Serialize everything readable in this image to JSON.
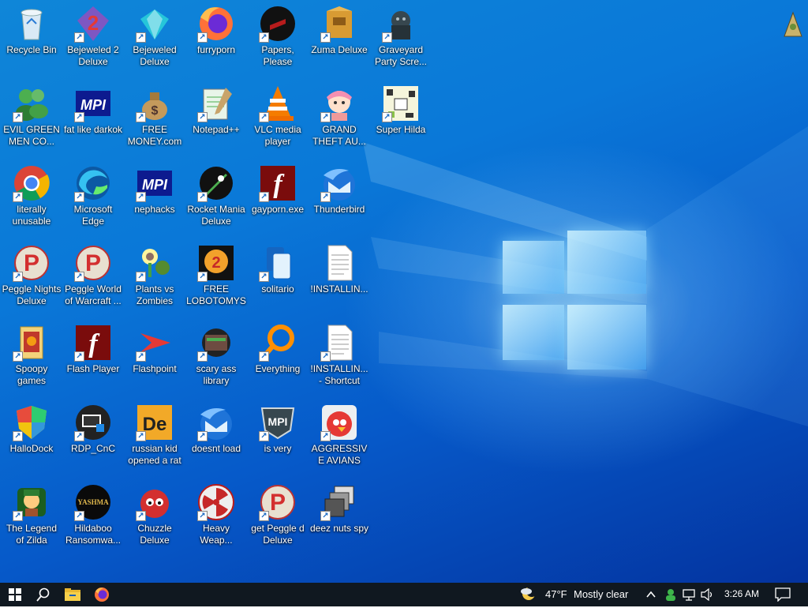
{
  "desktop": {
    "icons": [
      {
        "label": "Recycle Bin",
        "icon": "recycle-bin-icon"
      },
      {
        "label": "EVIL GREEN MEN CO...",
        "icon": "green-men-icon"
      },
      {
        "label": "literally unusable",
        "icon": "chrome-icon"
      },
      {
        "label": "Peggle Nights Deluxe",
        "icon": "peggle-icon"
      },
      {
        "label": "Spoopy games",
        "icon": "folder-icon"
      },
      {
        "label": "HalloDock",
        "icon": "shield-icon"
      },
      {
        "label": "The Legend of Zilda",
        "icon": "zilda-icon"
      },
      {
        "label": "Bejeweled 2 Deluxe",
        "icon": "bejeweled2-icon"
      },
      {
        "label": "fat like darkok",
        "icon": "mpi-icon"
      },
      {
        "label": "Microsoft Edge",
        "icon": "edge-icon"
      },
      {
        "label": "Peggle World of Warcraft ...",
        "icon": "peggle-icon"
      },
      {
        "label": "Flash Player",
        "icon": "flash-icon"
      },
      {
        "label": "RDP_CnC",
        "icon": "rdp-icon"
      },
      {
        "label": "Hildaboo Ransomwa...",
        "icon": "yashma-icon"
      },
      {
        "label": "Bejeweled Deluxe",
        "icon": "gem-icon"
      },
      {
        "label": "FREE MONEY.com",
        "icon": "money-bag-icon"
      },
      {
        "label": "nephacks",
        "icon": "mpi-icon"
      },
      {
        "label": "Plants vs Zombies",
        "icon": "plants-icon"
      },
      {
        "label": "Flashpoint",
        "icon": "flashpoint-icon"
      },
      {
        "label": "russian kid opened a rat",
        "icon": "de-icon"
      },
      {
        "label": "Chuzzle Deluxe",
        "icon": "chuzzle-icon"
      },
      {
        "label": "furryporn",
        "icon": "firefox-icon"
      },
      {
        "label": "Notepad++",
        "icon": "notepad-icon"
      },
      {
        "label": "Rocket Mania Deluxe",
        "icon": "rocket-icon"
      },
      {
        "label": "FREE LOBOTOMYS",
        "icon": "clock-icon"
      },
      {
        "label": "scary ass library",
        "icon": "library-icon"
      },
      {
        "label": "doesnt load",
        "icon": "thunderbird-icon"
      },
      {
        "label": "Heavy Weap...",
        "icon": "radiation-icon"
      },
      {
        "label": "Papers, Please",
        "icon": "papers-icon"
      },
      {
        "label": "VLC media player",
        "icon": "vlc-icon"
      },
      {
        "label": "gayporn.exe",
        "icon": "flash-icon"
      },
      {
        "label": "solitario",
        "icon": "solitaire-icon"
      },
      {
        "label": "Everything",
        "icon": "magnifier-icon"
      },
      {
        "label": "is very",
        "icon": "mpi-shield-icon"
      },
      {
        "label": "get Peggle d Deluxe",
        "icon": "peggle-icon"
      },
      {
        "label": "Zuma Deluxe",
        "icon": "zuma-icon"
      },
      {
        "label": "GRAND THEFT AU...",
        "icon": "anime-girl-icon"
      },
      {
        "label": "Thunderbird",
        "icon": "thunderbird-icon"
      },
      {
        "label": "!INSTALLIN...",
        "icon": "document-icon"
      },
      {
        "label": "!INSTALLIN... - Shortcut",
        "icon": "document-icon"
      },
      {
        "label": "AGGRESSIVE AVIANS",
        "icon": "angry-bird-icon"
      },
      {
        "label": "deez nuts spy",
        "icon": "windows-stack-icon"
      },
      {
        "label": "Graveyard Party Scre...",
        "icon": "graveyard-icon"
      },
      {
        "label": "Super Hilda",
        "icon": "pixel-icon"
      }
    ]
  },
  "taskbar": {
    "weather_temp": "47°F",
    "weather_text": "Mostly clear",
    "time": "3:26 AM"
  }
}
